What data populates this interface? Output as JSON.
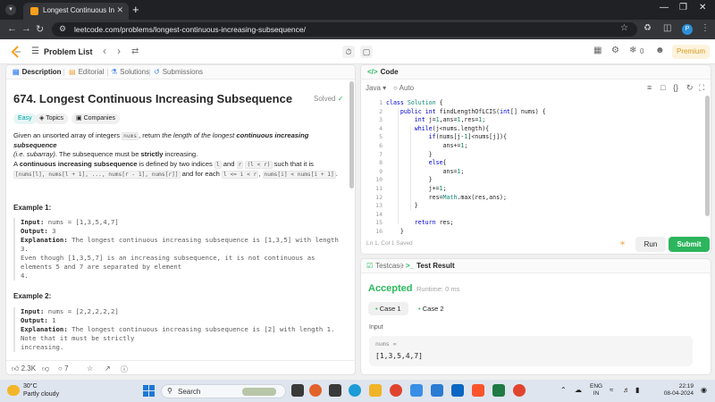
{
  "browser": {
    "tab_title": "Longest Continuous Increasin",
    "url": "leetcode.com/problems/longest-continuous-increasing-subsequence/"
  },
  "topbar": {
    "problem_list": "Problem List",
    "streak": "0",
    "premium": "Premium"
  },
  "left_tabs": [
    "Description",
    "Editorial",
    "Solutions",
    "Submissions"
  ],
  "problem": {
    "title": "674. Longest Continuous Increasing Subsequence",
    "solved": "Solved",
    "chips": [
      "Easy",
      "Topics",
      "Companies"
    ],
    "para1_a": "Given an unsorted array of integers ",
    "para1_code": "nums",
    "para1_b": ", return ",
    "para1_em": "the length of the longest ",
    "para1_strong": "continuous increasing subsequence",
    "para1_em2": "(i.e. subarray)",
    "para1_c": ". The subsequence must be ",
    "para1_strict": "strictly",
    "para1_d": " increasing.",
    "para2_a": "A ",
    "para2_strong": "continuous increasing subsequence",
    "para2_b": " is defined by two indices ",
    "para2_l": "l",
    "para2_and": " and ",
    "para2_r": "r",
    "para2_cond": "(l < r)",
    "para2_c": " such that it is ",
    "para2_seq": "[nums[l], nums[l + 1], ..., nums[r - 1], nums[r]]",
    "para2_d": " and for each ",
    "para2_range": "l <= i < r",
    "para2_e": ", ",
    "para2_rel": "nums[i] < nums[i + 1]",
    "para2_f": ".",
    "example1": {
      "heading": "Example 1:",
      "input_label": "Input:",
      "input": " nums = [1,3,5,4,7]",
      "output_label": "Output:",
      "output": " 3",
      "expl_label": "Explanation:",
      "expl_lines": [
        " The longest continuous increasing subsequence is [1,3,5] with length",
        "3.",
        "Even though [1,3,5,7] is an increasing subsequence, it is not continuous as",
        "elements 5 and 7 are separated by element",
        "4."
      ]
    },
    "example2": {
      "heading": "Example 2:",
      "input_label": "Input:",
      "input": " nums = [2,2,2,2,2]",
      "output_label": "Output:",
      "output": " 1",
      "expl_label": "Explanation:",
      "expl_lines": [
        " The longest continuous increasing subsequence is [2] with length 1.",
        "Note that it must be strictly",
        "increasing."
      ]
    }
  },
  "footer": {
    "likes": "2.3K",
    "comments": "7"
  },
  "editor": {
    "header": "Code",
    "language": "Java",
    "mode": "Auto",
    "line_numbers": [
      "1",
      "2",
      "3",
      "4",
      "5",
      "6",
      "7",
      "8",
      "9",
      "10",
      "11",
      "12",
      "13",
      "14",
      "15",
      "16"
    ],
    "status": "Ln 1, Col 1    Saved",
    "run": "Run",
    "submit": "Submit"
  },
  "result": {
    "tab_testcase": "Testcase",
    "tab_result": "Test Result",
    "status": "Accepted",
    "runtime": "Runtime: 0 ms",
    "cases": [
      "Case 1",
      "Case 2"
    ],
    "input_label": "Input",
    "var_name": "nums =",
    "var_value": "[1,3,5,4,7]"
  },
  "taskbar": {
    "temp": "30°C",
    "weather": "Partly cloudy",
    "search": "Search",
    "lang_top": "ENG",
    "lang_bottom": "IN",
    "time": "22:19",
    "date": "08-04-2024"
  }
}
